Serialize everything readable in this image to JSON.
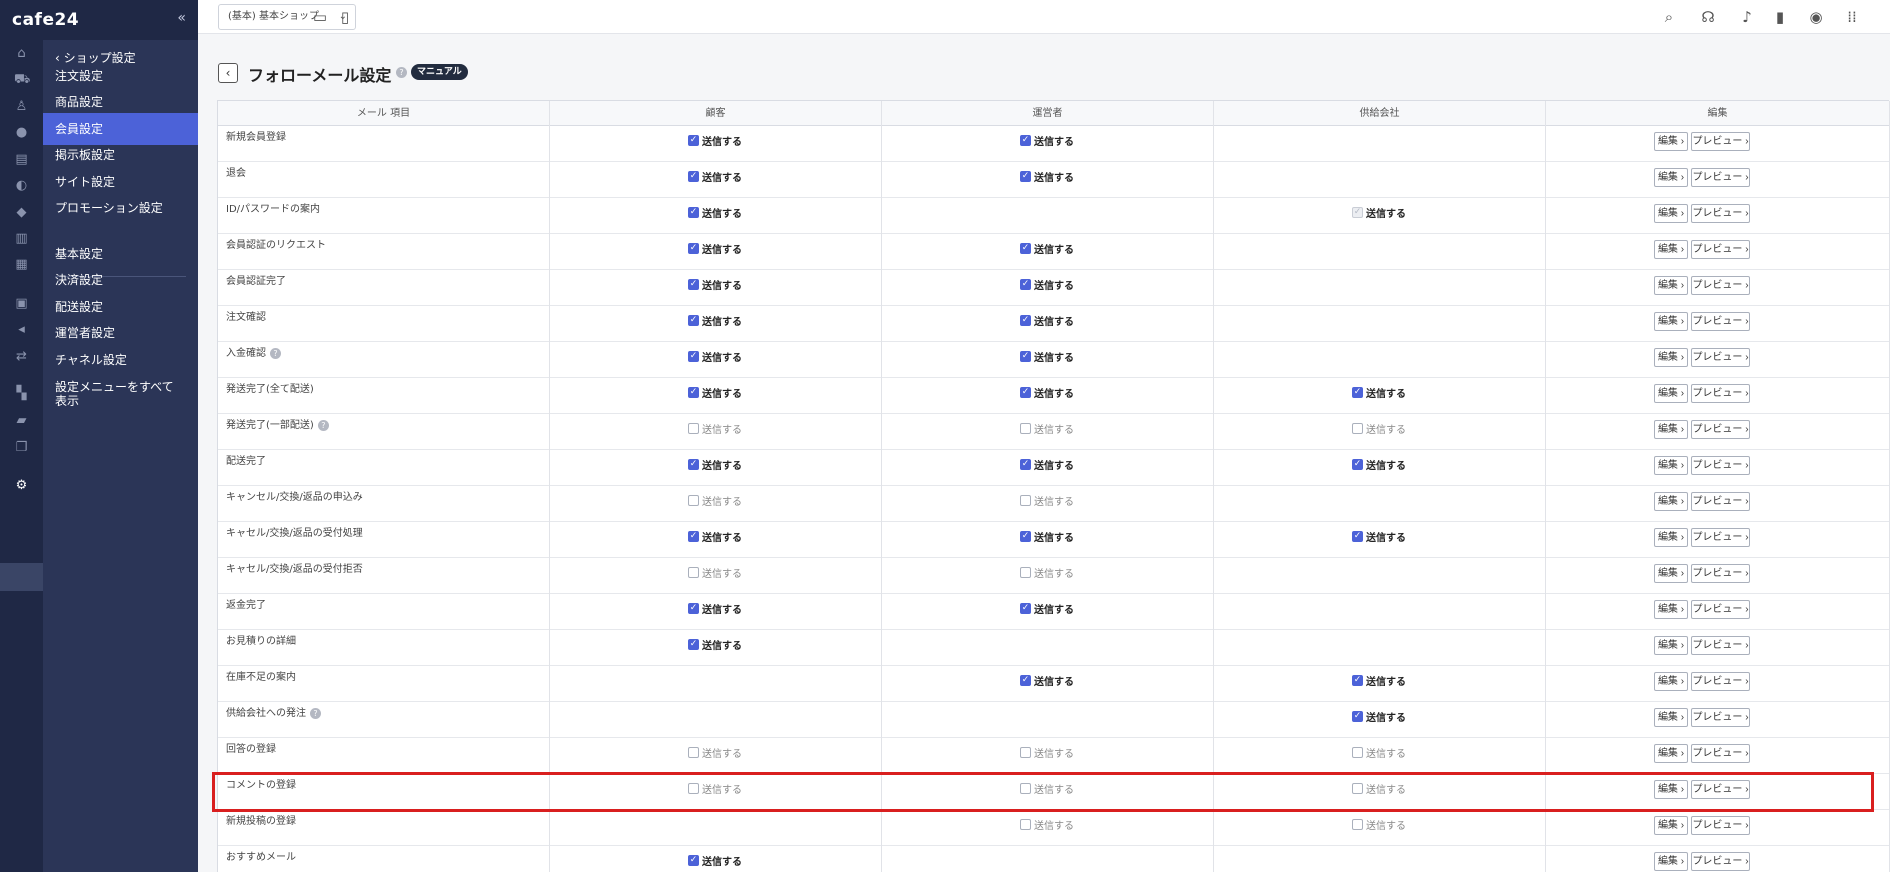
{
  "brand": {
    "logo": "cafe24",
    "collapse": "«"
  },
  "rail_icons": [
    "home-icon",
    "cart-icon",
    "shirt-icon",
    "user-icon",
    "board-icon",
    "palette-icon",
    "tag-icon",
    "chart-icon",
    "book-icon",
    "briefcase-icon",
    "megaphone-icon",
    "transfer-icon",
    "apps-icon",
    "folder-icon",
    "copy-icon",
    "gear-icon"
  ],
  "subnav": {
    "back_label": "‹  ショップ設定",
    "items": [
      "注文設定",
      "商品設定",
      "会員設定",
      "掲示板設定",
      "サイト設定",
      "プロモーション設定"
    ],
    "items2": [
      "基本設定",
      "決済設定",
      "配送設定",
      "運営者設定",
      "チャネル設定",
      "設定メニューをすべて表示"
    ]
  },
  "topbar": {
    "shop_select": "(基本) 基本ショップ"
  },
  "page": {
    "title": "フォローメール設定",
    "manual": "マニュアル",
    "back": "‹"
  },
  "table": {
    "headers": [
      "メール 項目",
      "顧客",
      "運営者",
      "供給会社",
      "編集"
    ],
    "edit_label": "編集 ›",
    "preview_label": "プレビュー ›",
    "send_label": "送信する",
    "rows": [
      {
        "name": "新規会員登録",
        "cust": "on",
        "op": "on",
        "sup": "none"
      },
      {
        "name": "退会",
        "cust": "on",
        "op": "on",
        "sup": "none"
      },
      {
        "name": "ID/パスワードの案内",
        "cust": "on",
        "op": "none",
        "sup": "disabled"
      },
      {
        "name": "会員認証のリクエスト",
        "cust": "on",
        "op": "on",
        "sup": "none"
      },
      {
        "name": "会員認証完了",
        "cust": "on",
        "op": "on",
        "sup": "none"
      },
      {
        "name": "注文確認",
        "cust": "on",
        "op": "on",
        "sup": "none"
      },
      {
        "name": "入金確認",
        "cust": "on",
        "op": "on",
        "sup": "none",
        "help": true
      },
      {
        "name": "発送完了(全て配送)",
        "cust": "on",
        "op": "on",
        "sup": "on"
      },
      {
        "name": "発送完了(一部配送)",
        "cust": "off",
        "op": "off",
        "sup": "off",
        "help": true
      },
      {
        "name": "配送完了",
        "cust": "on",
        "op": "on",
        "sup": "on"
      },
      {
        "name": "キャンセル/交換/返品の申込み",
        "cust": "off",
        "op": "off",
        "sup": "none"
      },
      {
        "name": "キャセル/交換/返品の受付処理",
        "cust": "on",
        "op": "on",
        "sup": "on"
      },
      {
        "name": "キャセル/交換/返品の受付拒否",
        "cust": "off",
        "op": "off",
        "sup": "none"
      },
      {
        "name": "返金完了",
        "cust": "on",
        "op": "on",
        "sup": "none"
      },
      {
        "name": "お見積りの詳細",
        "cust": "on",
        "op": "none",
        "sup": "none"
      },
      {
        "name": "在庫不足の案内",
        "cust": "none",
        "op": "on",
        "sup": "on"
      },
      {
        "name": "供給会社への発注",
        "cust": "none",
        "op": "none",
        "sup": "on",
        "help": true
      },
      {
        "name": "回答の登録",
        "cust": "off",
        "op": "off",
        "sup": "off"
      },
      {
        "name": "コメントの登録",
        "cust": "off",
        "op": "off",
        "sup": "off"
      },
      {
        "name": "新規投稿の登録",
        "cust": "none",
        "op": "off",
        "sup": "off"
      },
      {
        "name": "おすすめメール",
        "cust": "on",
        "op": "none",
        "sup": "none"
      }
    ]
  }
}
